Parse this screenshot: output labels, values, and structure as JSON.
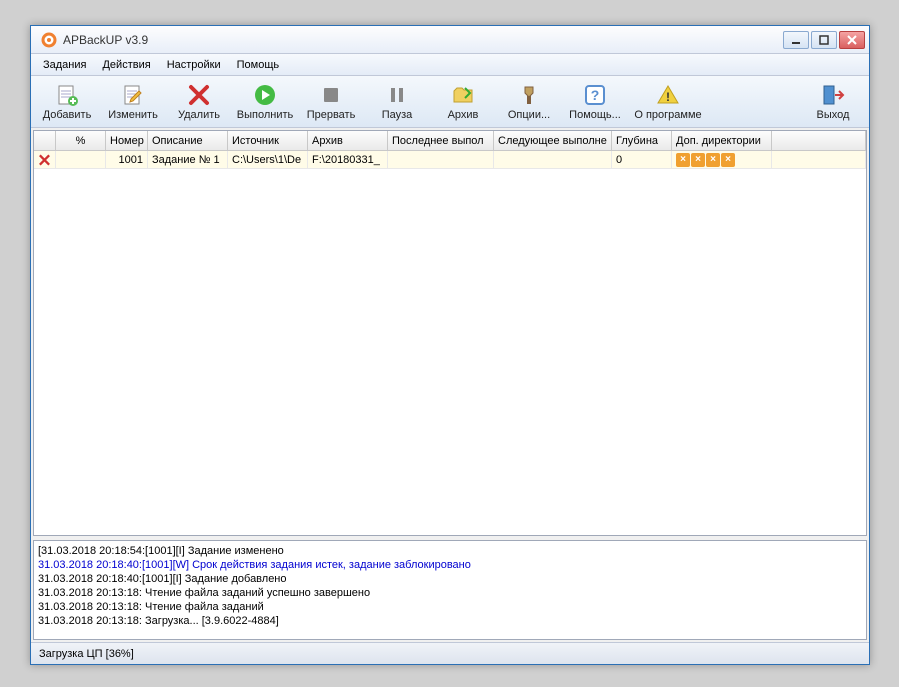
{
  "window": {
    "title": "APBackUP v3.9"
  },
  "menubar": {
    "items": [
      "Задания",
      "Действия",
      "Настройки",
      "Помощь"
    ]
  },
  "toolbar": {
    "add": "Добавить",
    "edit": "Изменить",
    "delete": "Удалить",
    "run": "Выполнить",
    "stop": "Прервать",
    "pause": "Пауза",
    "archive": "Архив",
    "options": "Опции...",
    "help": "Помощь...",
    "about": "О программе",
    "exit": "Выход"
  },
  "grid": {
    "columns": {
      "status": "",
      "percent": "%",
      "number": "Номер",
      "description": "Описание",
      "source": "Источник",
      "archive": "Архив",
      "last_run": "Последнее выпол",
      "next_run": "Следующее выполне",
      "depth": "Глубина",
      "add_dirs": "Доп. директории"
    },
    "rows": [
      {
        "status": "error",
        "percent": "",
        "number": "1001",
        "description": "Задание № 1",
        "source": "C:\\Users\\1\\De",
        "archive": "F:\\20180331_",
        "last_run": "",
        "next_run": "",
        "depth": "0",
        "add_dirs_flags": 4
      }
    ]
  },
  "log": {
    "lines": [
      {
        "text": "[31.03.2018 20:18:54:[1001][I] Задание изменено",
        "color": "normal"
      },
      {
        "text": "31.03.2018 20:18:40:[1001][W] Срок действия задания истек, задание заблокировано",
        "color": "blue"
      },
      {
        "text": "31.03.2018 20:18:40:[1001][I] Задание добавлено",
        "color": "normal"
      },
      {
        "text": "31.03.2018 20:13:18: Чтение файла заданий успешно завершено",
        "color": "normal"
      },
      {
        "text": "31.03.2018 20:13:18: Чтение файла заданий",
        "color": "normal"
      },
      {
        "text": "31.03.2018 20:13:18: Загрузка... [3.9.6022-4884]",
        "color": "normal"
      }
    ]
  },
  "statusbar": {
    "text": "Загрузка ЦП [36%]"
  },
  "colors": {
    "accent_orange": "#f0a030",
    "titlebar_border": "#2a6fb5"
  }
}
